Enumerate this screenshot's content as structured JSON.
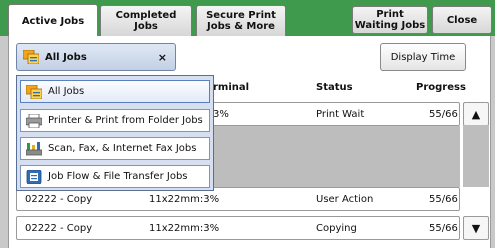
{
  "tabs": [
    {
      "label": "Active Jobs"
    },
    {
      "label": "Completed\nJobs"
    },
    {
      "label": "Secure Print\nJobs & More"
    },
    {
      "label": "Print\nWaiting Jobs"
    },
    {
      "label": "Close"
    }
  ],
  "filter": {
    "selected": "All Jobs",
    "clear_icon": "×"
  },
  "display_time_label": "Display Time",
  "columns": {
    "terminal": "rminal",
    "status": "Status",
    "progress": "Progress"
  },
  "rows": [
    {
      "terminal": "3%",
      "status": "Print Wait",
      "progress": "55/66"
    },
    {
      "owner": "02222 - Copy",
      "terminal": "11x22mm:3%",
      "status": "User Action",
      "progress": "55/66"
    },
    {
      "owner": "02222 - Copy",
      "terminal": "11x22mm:3%",
      "status": "Copying",
      "progress": "55/66"
    }
  ],
  "scroll": {
    "up": "▲",
    "down": "▼"
  },
  "dropdown_options": [
    {
      "label": "All Jobs",
      "icon": "all-jobs-icon"
    },
    {
      "label": "Printer & Print from Folder Jobs",
      "icon": "printer-icon"
    },
    {
      "label": "Scan, Fax, & Internet Fax Jobs",
      "icon": "scanner-icon"
    },
    {
      "label": "Job Flow & File Transfer Jobs",
      "icon": "job-flow-icon"
    }
  ]
}
